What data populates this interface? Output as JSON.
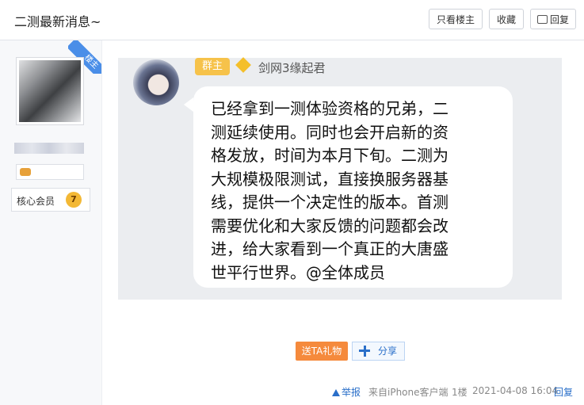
{
  "header": {
    "title": "二测最新消息~",
    "only_author_label": "只看楼主",
    "favorite_label": "收藏",
    "reply_label": "回复"
  },
  "sidebar": {
    "ribbon_label": "楼主",
    "member_label": "核心会员",
    "member_level": "7"
  },
  "screenshot": {
    "role_badge": "群主",
    "sender_name": "剑网3缘起君",
    "message": "已经拿到一测体验资格的兄弟，二\n测延续使用。同时也会开启新的资\n格发放，时间为本月下旬。二测为\n大规模极限测试，直接换服务器基\n线，提供一个决定性的版本。首测\n需要优化和大家反馈的问题都会改\n进，给大家看到一个真正的大唐盛\n世平行世界。@全体成员"
  },
  "actions": {
    "gift_label": "送TA礼物",
    "share_label": "分享"
  },
  "footer": {
    "report_label": "举报",
    "source": "来自iPhone客户端",
    "floor": "1楼",
    "time": "2021-04-08 16:04",
    "reply_label": "回复"
  },
  "colors": {
    "accent_blue": "#2a6fc9",
    "gift_orange": "#f58a3c",
    "badge_yellow": "#f6c24a"
  }
}
